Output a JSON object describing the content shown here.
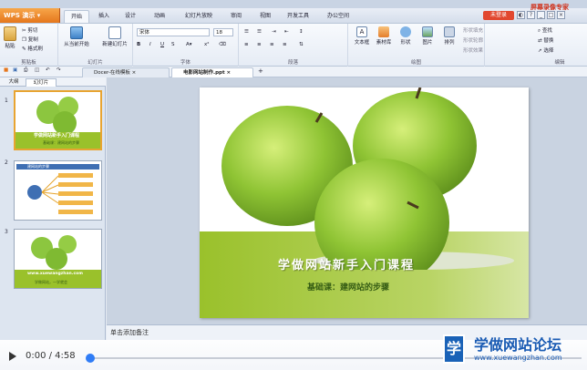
{
  "app": {
    "title": "WPS 演示"
  },
  "menu": {
    "tabs": [
      "开始",
      "插入",
      "设计",
      "动画",
      "幻灯片放映",
      "审阅",
      "视图",
      "开发工具",
      "办公空间"
    ],
    "login": "未登录",
    "brand": "屏幕录像专家"
  },
  "ribbon": {
    "paste": "粘贴",
    "cut": "剪切",
    "copy": "复制",
    "format_painter": "格式刷",
    "clipboard_group": "剪贴板",
    "from_start": "从当前开始",
    "new_slide": "新建幻灯片",
    "slides_group": "幻灯片",
    "font_name": "宋体",
    "font_size": "18",
    "font_group": "字体",
    "paragraph_group": "段落",
    "textbox": "文本框",
    "material": "素材库",
    "shape": "形状",
    "picture": "图片",
    "arrange": "排列",
    "drawing_group": "绘图",
    "shape_fill": "形状填充",
    "shape_outline": "形状轮廓",
    "shape_effect": "形状效果",
    "find": "查找",
    "replace": "替换",
    "select": "选择",
    "edit_group": "编辑"
  },
  "doc_tabs": [
    {
      "label": "Docer-在线模板"
    },
    {
      "label": "电影网站制作.ppt"
    }
  ],
  "panel": {
    "tab_outline": "大纲",
    "tab_slides": "幻灯片"
  },
  "thumbs": [
    {
      "num": "1",
      "title": "学做网站新手入门课程",
      "sub": "基础课：建网站的步骤"
    },
    {
      "num": "2",
      "title": "建网站的步骤",
      "sub": "www.xuewangzhan.com"
    },
    {
      "num": "3",
      "title": "www.xuewangzhan.com",
      "sub": "学做网站，一学就会"
    }
  ],
  "slide": {
    "title": "学做网站新手入门课程",
    "subtitle": "基础课：建网站的步骤"
  },
  "notes_placeholder": "单击添加备注",
  "player": {
    "time": "0:00 / 4:58",
    "progress": 0.0
  },
  "watermark": {
    "name": "学做网站论坛",
    "url": "www.xuewangzhan.com",
    "logo_letter": "学"
  },
  "colors": {
    "accent": "#e5761c",
    "slide_green": "#9ac12b",
    "brand_blue": "#1a5bb3"
  }
}
